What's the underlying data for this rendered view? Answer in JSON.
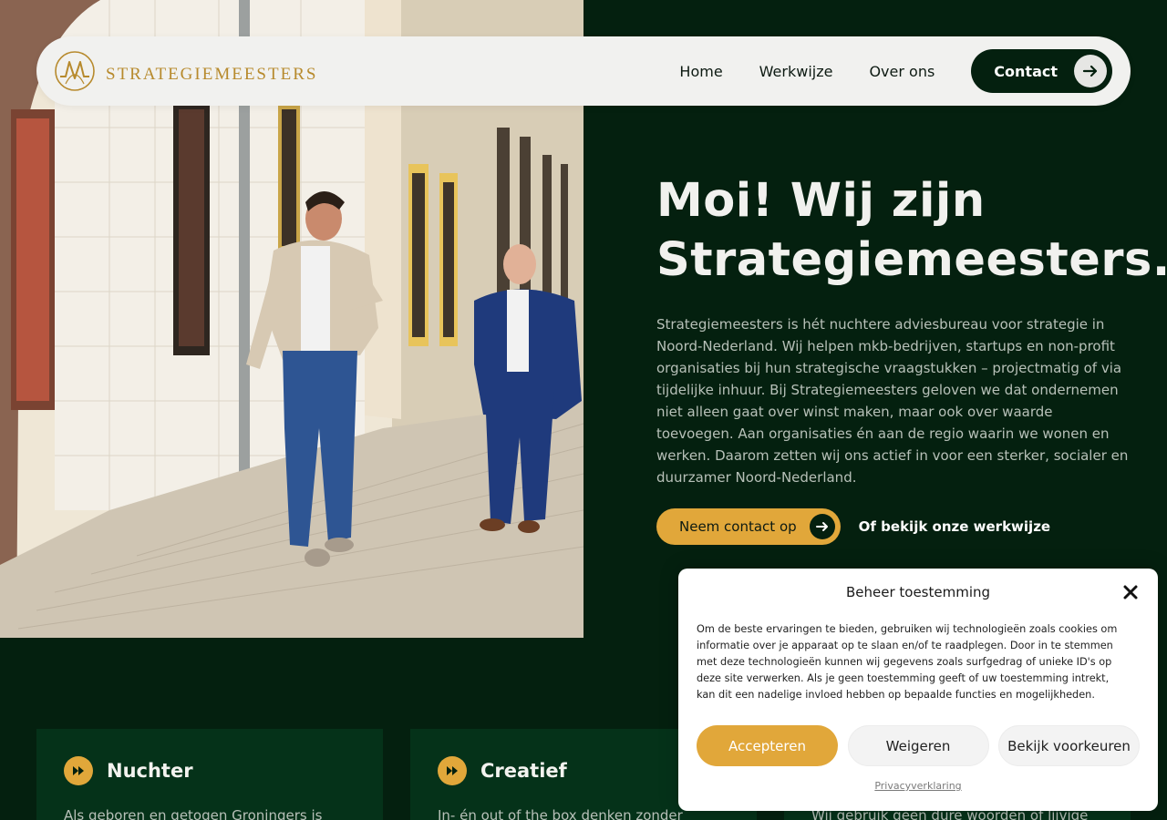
{
  "brand": {
    "name": "Strategiemeesters"
  },
  "nav": {
    "links": [
      "Home",
      "Werkwijze",
      "Over ons"
    ],
    "contact_label": "Contact"
  },
  "hero": {
    "title_line1": "Moi! Wij zijn",
    "title_line2": "Strategiemeesters.",
    "description": "Strategiemeesters is hét nuchtere adviesbureau voor strategie in Noord-Nederland. Wij helpen mkb-bedrijven, startups en non-profit organisaties bij hun strategische vraagstukken – projectmatig of via tijdelijke inhuur. Bij Strategiemeesters geloven we dat ondernemen niet alleen gaat over winst maken, maar ook over waarde toevoegen. Aan organisaties én aan de regio waarin we wonen en werken. Daarom zetten wij ons actief in voor een sterker, socialer en duurzamer Noord-Nederland.",
    "cta_primary": "Neem contact op",
    "cta_secondary": "Of bekijk onze werkwijze"
  },
  "cards": [
    {
      "title": "Nuchter",
      "text": "Als geboren en getogen Groningers is"
    },
    {
      "title": "Creatief",
      "text": "In- én out of the box denken zonder"
    },
    {
      "title": "",
      "text": "Wij gebruik geen dure woorden of lijvige"
    }
  ],
  "consent": {
    "title": "Beheer toestemming",
    "text": "Om de beste ervaringen te bieden, gebruiken wij technologieën zoals cookies om informatie over je apparaat op te slaan en/of te raadplegen. Door in te stemmen met deze technologieën kunnen wij gegevens zoals surfgedrag of unieke ID's op deze site verwerken. Als je geen toestemming geeft of uw toestemming intrekt, kan dit een nadelige invloed hebben op bepaalde functies en mogelijkheden.",
    "accept": "Accepteren",
    "deny": "Weigeren",
    "preferences": "Bekijk voorkeuren",
    "privacy_link": "Privacyverklaring"
  },
  "colors": {
    "background": "#04200f",
    "accent": "#e1a73a",
    "card": "#053219",
    "brand_gold": "#b78a2d"
  },
  "icons": {
    "contact_arrow": "arrow-right-icon",
    "cta_arrow": "arrow-right-icon",
    "card_icon": "fast-forward-icon",
    "consent_close": "close-icon"
  }
}
